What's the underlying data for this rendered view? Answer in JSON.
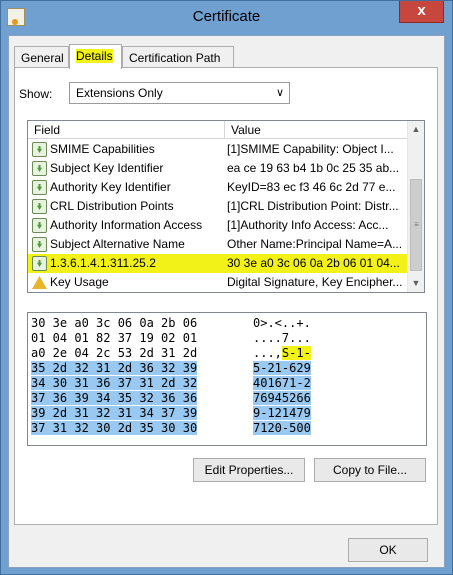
{
  "window": {
    "title": "Certificate",
    "close_glyph": "x"
  },
  "tabs": [
    {
      "label": "General"
    },
    {
      "label": "Details"
    },
    {
      "label": "Certification Path"
    }
  ],
  "show": {
    "label": "Show:",
    "value": "Extensions Only"
  },
  "list": {
    "headers": {
      "field": "Field",
      "value": "Value"
    },
    "rows": [
      {
        "icon": "extension-icon",
        "field": "SMIME Capabilities",
        "value": "[1]SMIME Capability: Object I..."
      },
      {
        "icon": "extension-icon",
        "field": "Subject Key Identifier",
        "value": "ea ce 19 63 b4 1b 0c 25 35 ab..."
      },
      {
        "icon": "extension-icon",
        "field": "Authority Key Identifier",
        "value": "KeyID=83 ec f3 46 6c 2d 77 e..."
      },
      {
        "icon": "extension-icon",
        "field": "CRL Distribution Points",
        "value": "[1]CRL Distribution Point: Distr..."
      },
      {
        "icon": "extension-icon",
        "field": "Authority Information Access",
        "value": "[1]Authority Info Access: Acc..."
      },
      {
        "icon": "extension-icon",
        "field": "Subject Alternative Name",
        "value": "Other Name:Principal Name=A..."
      },
      {
        "icon": "extension-icon",
        "field": "1.3.6.1.4.1.311.25.2",
        "value": "30 3e a0 3c 06 0a 2b 06 01 04...",
        "selected": true
      },
      {
        "icon": "warning-icon",
        "field": "Key Usage",
        "value": "Digital Signature, Key Encipher..."
      }
    ]
  },
  "hex": {
    "lines": [
      {
        "bytes": "30 3e a0 3c 06 0a 2b 06",
        "ascii": "0>.<..+."
      },
      {
        "bytes": "01 04 01 82 37 19 02 01",
        "ascii": "....7..."
      },
      {
        "bytes": "a0 2e 04 2c 53 2d 31 2d",
        "ascii_pre": "...,",
        "ascii_hl": "S-1-"
      },
      {
        "bytes": "35 2d 32 31 2d 36 32 39",
        "ascii": "5-21-629",
        "selected": true
      },
      {
        "bytes": "34 30 31 36 37 31 2d 32",
        "ascii": "401671-2",
        "selected": true
      },
      {
        "bytes": "37 36 39 34 35 32 36 36",
        "ascii": "76945266",
        "selected": true
      },
      {
        "bytes": "39 2d 31 32 31 34 37 39",
        "ascii": "9-121479",
        "selected": true
      },
      {
        "bytes": "37 31 32 30 2d 35 30 30",
        "ascii": "7120-500",
        "selected": true
      }
    ]
  },
  "buttons": {
    "edit_properties": "Edit Properties...",
    "copy_to_file": "Copy to File...",
    "ok": "OK"
  },
  "colors": {
    "highlight_yellow": "#f2f218",
    "selection_blue": "#99c9f1",
    "title_bar": "#6fa0cf"
  }
}
